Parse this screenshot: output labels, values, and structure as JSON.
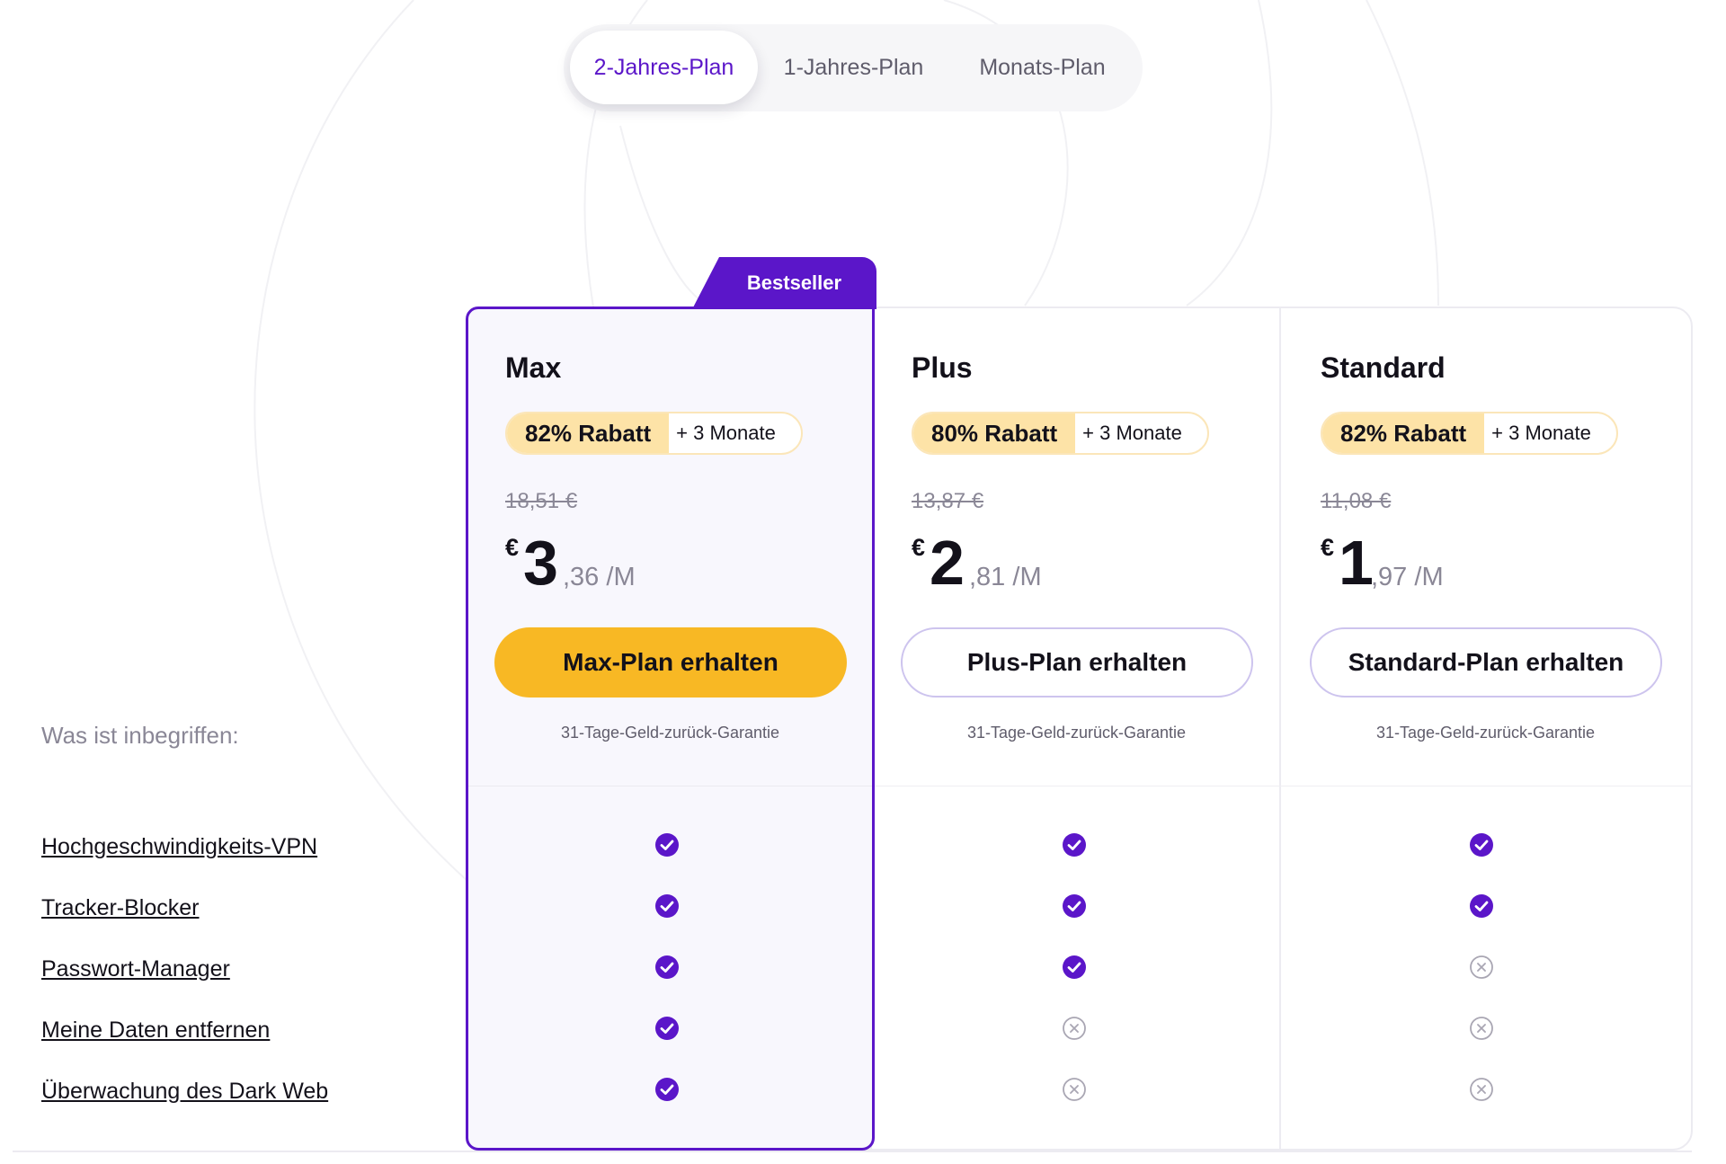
{
  "billing_toggle": {
    "options": [
      "2-Jahres-Plan",
      "1-Jahres-Plan",
      "Monats-Plan"
    ],
    "selected": "2-Jahres-Plan"
  },
  "bestseller_label": "Bestseller",
  "plans": [
    {
      "name": "Max",
      "discount": "82% Rabatt",
      "bonus": "+ 3 Monate",
      "old_price": "18,51 €",
      "currency": "€",
      "price_main": "3",
      "price_cents": ",36",
      "price_period": "/M",
      "cta": "Max-Plan erhalten",
      "guarantee": "31-Tage-Geld-zurück-Garantie"
    },
    {
      "name": "Plus",
      "discount": "80% Rabatt",
      "bonus": "+ 3 Monate",
      "old_price": "13,87 €",
      "currency": "€",
      "price_main": "2",
      "price_cents": ",81",
      "price_period": "/M",
      "cta": "Plus-Plan erhalten",
      "guarantee": "31-Tage-Geld-zurück-Garantie"
    },
    {
      "name": "Standard",
      "discount": "82% Rabatt",
      "bonus": "+ 3 Monate",
      "old_price": "11,08 €",
      "currency": "€",
      "price_main": "1",
      "price_cents": ",97",
      "price_period": "/M",
      "cta": "Standard-Plan erhalten",
      "guarantee": "31-Tage-Geld-zurück-Garantie"
    }
  ],
  "included_label": "Was ist inbegriffen:",
  "features": [
    "Hochgeschwindigkeits-VPN",
    "Tracker-Blocker",
    "Passwort-Manager",
    "Meine Daten entfernen",
    "Überwachung des Dark Web"
  ],
  "feature_availability": [
    [
      true,
      true,
      true
    ],
    [
      true,
      true,
      true
    ],
    [
      true,
      true,
      false
    ],
    [
      true,
      false,
      false
    ],
    [
      true,
      false,
      false
    ]
  ],
  "icons": {
    "included": "check-circle-icon",
    "excluded": "x-circle-icon"
  },
  "colors": {
    "accent_purple": "#5b16c9",
    "cta_yellow": "#f8b824",
    "discount_badge": "#fde3a7",
    "muted_text": "#8a8796"
  }
}
